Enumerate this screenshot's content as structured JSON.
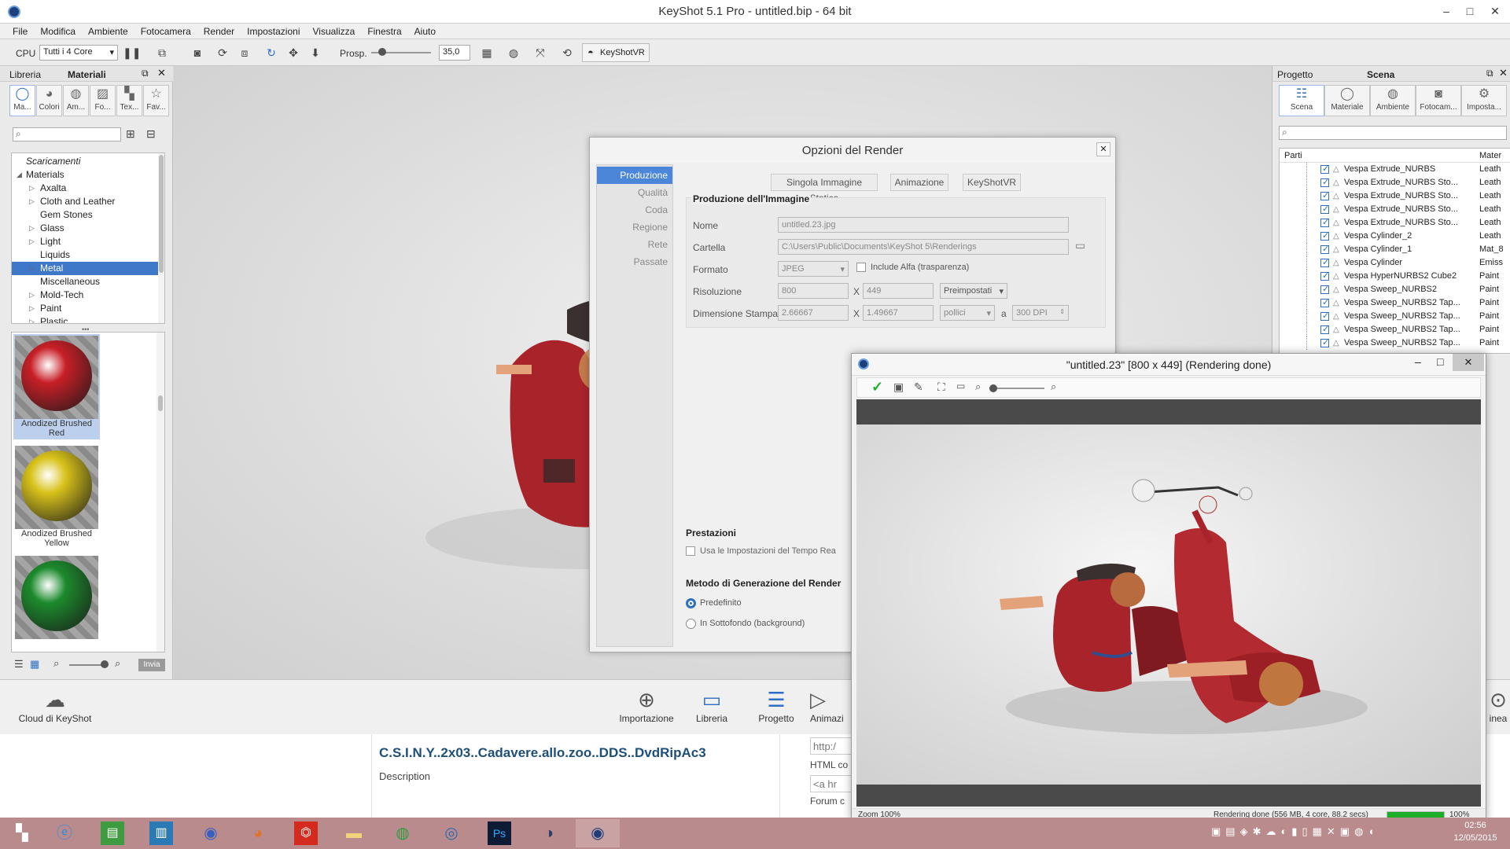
{
  "window": {
    "title": "KeyShot 5.1 Pro  - untitled.bip  - 64 bit",
    "min": "–",
    "max": "□",
    "close": "✕"
  },
  "menu": [
    "File",
    "Modifica",
    "Ambiente",
    "Fotocamera",
    "Render",
    "Impostazioni",
    "Visualizza",
    "Finestra",
    "Aiuto"
  ],
  "toolbar": {
    "cpu_label": "CPU",
    "cores": "Tutti i 4 Core",
    "prosp_label": "Prosp.",
    "prosp_value": "35,0",
    "keyshotvr": "KeyShotVR"
  },
  "left_panel": {
    "tab_libreria": "Libreria",
    "tab_materiali": "Materiali",
    "cat_tabs": [
      "Ma...",
      "Colori",
      "Am...",
      "Fo...",
      "Tex...",
      "Fav..."
    ],
    "search_placeholder": "",
    "tree": [
      {
        "label": "Scaricamenti",
        "arrow": "",
        "indent": 0,
        "italic": true
      },
      {
        "label": "Materials",
        "arrow": "◢",
        "indent": 0
      },
      {
        "label": "Axalta",
        "arrow": "▷",
        "indent": 1
      },
      {
        "label": "Cloth and Leather",
        "arrow": "▷",
        "indent": 1
      },
      {
        "label": "Gem Stones",
        "arrow": "",
        "indent": 1
      },
      {
        "label": "Glass",
        "arrow": "▷",
        "indent": 1
      },
      {
        "label": "Light",
        "arrow": "▷",
        "indent": 1
      },
      {
        "label": "Liquids",
        "arrow": "",
        "indent": 1
      },
      {
        "label": "Metal",
        "arrow": "▷",
        "indent": 1,
        "selected": true
      },
      {
        "label": "Miscellaneous",
        "arrow": "",
        "indent": 1
      },
      {
        "label": "Mold-Tech",
        "arrow": "▷",
        "indent": 1
      },
      {
        "label": "Paint",
        "arrow": "▷",
        "indent": 1
      },
      {
        "label": "Plastic",
        "arrow": "▷",
        "indent": 1
      }
    ],
    "materials": [
      {
        "label": "Anodized Brushed Red",
        "color": "#c81f27"
      },
      {
        "label": "Anodized Brushed Yellow",
        "color": "#d8c21a"
      },
      {
        "label": "",
        "color": "#1c8a2c"
      }
    ],
    "invia": "Invia"
  },
  "right_panel": {
    "tab_progetto": "Progetto",
    "tab_scena": "Scena",
    "tabs": [
      "Scena",
      "Materiale",
      "Ambiente",
      "Fotocam...",
      "Imposta..."
    ],
    "col_parti": "Parti",
    "col_mater": "Mater",
    "rows": [
      {
        "name": "Vespa Extrude_NURBS",
        "mat": "Leath"
      },
      {
        "name": "Vespa Extrude_NURBS Sto...",
        "mat": "Leath"
      },
      {
        "name": "Vespa Extrude_NURBS Sto...",
        "mat": "Leath"
      },
      {
        "name": "Vespa Extrude_NURBS Sto...",
        "mat": "Leath"
      },
      {
        "name": "Vespa Extrude_NURBS Sto...",
        "mat": "Leath"
      },
      {
        "name": "Vespa Cylinder_2",
        "mat": "Leath"
      },
      {
        "name": "Vespa Cylinder_1",
        "mat": "Mat_8"
      },
      {
        "name": "Vespa Cylinder",
        "mat": "Emiss"
      },
      {
        "name": "Vespa HyperNURBS2 Cube2",
        "mat": "Paint"
      },
      {
        "name": "Vespa Sweep_NURBS2",
        "mat": "Paint"
      },
      {
        "name": "Vespa Sweep_NURBS2 Tap...",
        "mat": "Paint"
      },
      {
        "name": "Vespa Sweep_NURBS2 Tap...",
        "mat": "Paint"
      },
      {
        "name": "Vespa Sweep_NURBS2 Tap...",
        "mat": "Paint"
      },
      {
        "name": "Vespa Sweep_NURBS2 Tap...",
        "mat": "Paint"
      }
    ]
  },
  "dock": {
    "cloud": "Cloud di KeyShot",
    "importazione": "Importazione",
    "libreria": "Libreria",
    "progetto": "Progetto",
    "animazione": "Animazi",
    "linea": "inea"
  },
  "render_options": {
    "title": "Opzioni del Render",
    "side": [
      "Produzione",
      "Qualità",
      "Coda",
      "Regione",
      "Rete",
      "Passate"
    ],
    "mode_buttons": [
      "Singola Immagine Statica",
      "Animazione",
      "KeyShotVR"
    ],
    "section_title": "Produzione dell'Immagine",
    "nome_label": "Nome",
    "nome_value": "untitled.23.jpg",
    "cartella_label": "Cartella",
    "cartella_value": "C:\\Users\\Public\\Documents\\KeyShot 5\\Renderings",
    "formato_label": "Formato",
    "formato_value": "JPEG",
    "alfa_label": "Include Alfa (trasparenza)",
    "risoluzione_label": "Risoluzione",
    "res_w": "800",
    "res_h": "449",
    "preimpostati": "Preimpostati",
    "dimensione_label": "Dimensione Stampa",
    "dim_w": "2.66667",
    "dim_h": "1.49667",
    "unit": "pollici",
    "a_label": "a",
    "dpi": "300 DPI",
    "x_label": "X",
    "prestazioni_title": "Prestazioni",
    "prestazioni_check": "Usa le Impostazioni del Tempo Rea",
    "metodo_title": "Metodo di Generazione del Render",
    "predefinito": "Predefinito",
    "sottofondo": "In Sottofondo (background)"
  },
  "render_window": {
    "title": "\"untitled.23\" [800 x 449] (Rendering done)",
    "zoom": "Zoom 100%",
    "status": "Rendering done (556 MB, 4 core, 88.2 secs)",
    "progress_label": "100%",
    "progress": 1.0
  },
  "browser": {
    "heading": "C.S.I.N.Y..2x03..Cadavere.allo.zoo..DDS..DvdRipAc3",
    "description": "Description",
    "http": "http:/",
    "html_code": "HTML co",
    "a_href": "<a hr",
    "forum": "Forum c"
  },
  "taskbar": {
    "time": "02:56",
    "date": "12/05/2015"
  },
  "colors": {
    "accent": "#2b6ec7",
    "selection": "#3f77c9",
    "taskbar": "#b98b8c",
    "progress": "#1fae2a",
    "vespa": "#a8232a"
  }
}
